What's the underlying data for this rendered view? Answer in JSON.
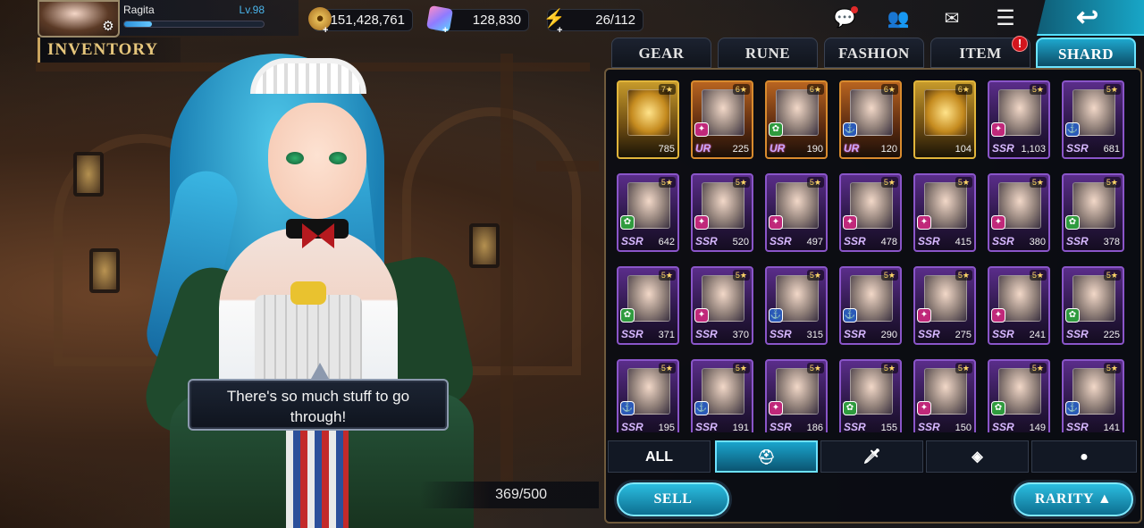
{
  "player": {
    "name": "Ragita",
    "level": "Lv.98",
    "xp_fraction": 0.2
  },
  "currencies": [
    {
      "name": "gold-coin-icon",
      "value": "151,428,761"
    },
    {
      "name": "gem-icon",
      "value": "128,830"
    },
    {
      "name": "energy-icon",
      "value": "26/112"
    }
  ],
  "screen": {
    "title": "INVENTORY"
  },
  "dialogue": {
    "line1": "There's so much stuff to go",
    "line2": "through!"
  },
  "capacity": "369/500",
  "tabs": [
    {
      "label": "GEAR",
      "active": false
    },
    {
      "label": "RUNE",
      "active": false
    },
    {
      "label": "FASHION",
      "active": false
    },
    {
      "label": "ITEM",
      "active": false,
      "alert": "!"
    },
    {
      "label": "SHARD",
      "active": true
    }
  ],
  "shards": [
    {
      "stars": "7★",
      "grade": "",
      "count": "785",
      "type": "gold",
      "element": ""
    },
    {
      "stars": "6★",
      "grade": "UR",
      "count": "225",
      "type": "ur",
      "element": "dark"
    },
    {
      "stars": "6★",
      "grade": "UR",
      "count": "190",
      "type": "ur",
      "element": "nature"
    },
    {
      "stars": "6★",
      "grade": "UR",
      "count": "120",
      "type": "ur",
      "element": "light"
    },
    {
      "stars": "6★",
      "grade": "",
      "count": "104",
      "type": "helm",
      "element": ""
    },
    {
      "stars": "5★",
      "grade": "SSR",
      "count": "1,103",
      "type": "ssr",
      "element": "dark"
    },
    {
      "stars": "5★",
      "grade": "SSR",
      "count": "681",
      "type": "ssr",
      "element": "light"
    },
    {
      "stars": "5★",
      "grade": "SSR",
      "count": "642",
      "type": "ssr",
      "element": "nature"
    },
    {
      "stars": "5★",
      "grade": "SSR",
      "count": "520",
      "type": "ssr",
      "element": "dark"
    },
    {
      "stars": "5★",
      "grade": "SSR",
      "count": "497",
      "type": "ssr",
      "element": "dark"
    },
    {
      "stars": "5★",
      "grade": "SSR",
      "count": "478",
      "type": "ssr",
      "element": "dark"
    },
    {
      "stars": "5★",
      "grade": "SSR",
      "count": "415",
      "type": "ssr",
      "element": "dark"
    },
    {
      "stars": "5★",
      "grade": "SSR",
      "count": "380",
      "type": "ssr",
      "element": "dark"
    },
    {
      "stars": "5★",
      "grade": "SSR",
      "count": "378",
      "type": "ssr",
      "element": "nature"
    },
    {
      "stars": "5★",
      "grade": "SSR",
      "count": "371",
      "type": "ssr",
      "element": "nature"
    },
    {
      "stars": "5★",
      "grade": "SSR",
      "count": "370",
      "type": "ssr",
      "element": "dark"
    },
    {
      "stars": "5★",
      "grade": "SSR",
      "count": "315",
      "type": "ssr",
      "element": "light"
    },
    {
      "stars": "5★",
      "grade": "SSR",
      "count": "290",
      "type": "ssr",
      "element": "light"
    },
    {
      "stars": "5★",
      "grade": "SSR",
      "count": "275",
      "type": "ssr",
      "element": "dark"
    },
    {
      "stars": "5★",
      "grade": "SSR",
      "count": "241",
      "type": "ssr",
      "element": "dark"
    },
    {
      "stars": "5★",
      "grade": "SSR",
      "count": "225",
      "type": "ssr",
      "element": "nature"
    },
    {
      "stars": "5★",
      "grade": "SSR",
      "count": "195",
      "type": "ssr",
      "element": "light"
    },
    {
      "stars": "5★",
      "grade": "SSR",
      "count": "191",
      "type": "ssr",
      "element": "light"
    },
    {
      "stars": "5★",
      "grade": "SSR",
      "count": "186",
      "type": "ssr",
      "element": "dark"
    },
    {
      "stars": "5★",
      "grade": "SSR",
      "count": "155",
      "type": "ssr",
      "element": "nature"
    },
    {
      "stars": "5★",
      "grade": "SSR",
      "count": "150",
      "type": "ssr",
      "element": "dark"
    },
    {
      "stars": "5★",
      "grade": "SSR",
      "count": "149",
      "type": "ssr",
      "element": "nature"
    },
    {
      "stars": "5★",
      "grade": "SSR",
      "count": "141",
      "type": "ssr",
      "element": "light"
    }
  ],
  "filters": [
    {
      "label": "ALL",
      "icon": "",
      "active": false
    },
    {
      "label": "",
      "icon": "helmet-icon",
      "active": true
    },
    {
      "label": "",
      "icon": "sword-icon",
      "active": false
    },
    {
      "label": "",
      "icon": "diamond-icon",
      "active": false
    },
    {
      "label": "",
      "icon": "pouch-icon",
      "active": false
    }
  ],
  "buttons": {
    "sell": "SELL",
    "rarity": "RARITY ▲"
  },
  "colors": {
    "accent": "#1ea7cd",
    "ssr_border": "#8a55c9",
    "ur_border": "#d98b2e"
  }
}
